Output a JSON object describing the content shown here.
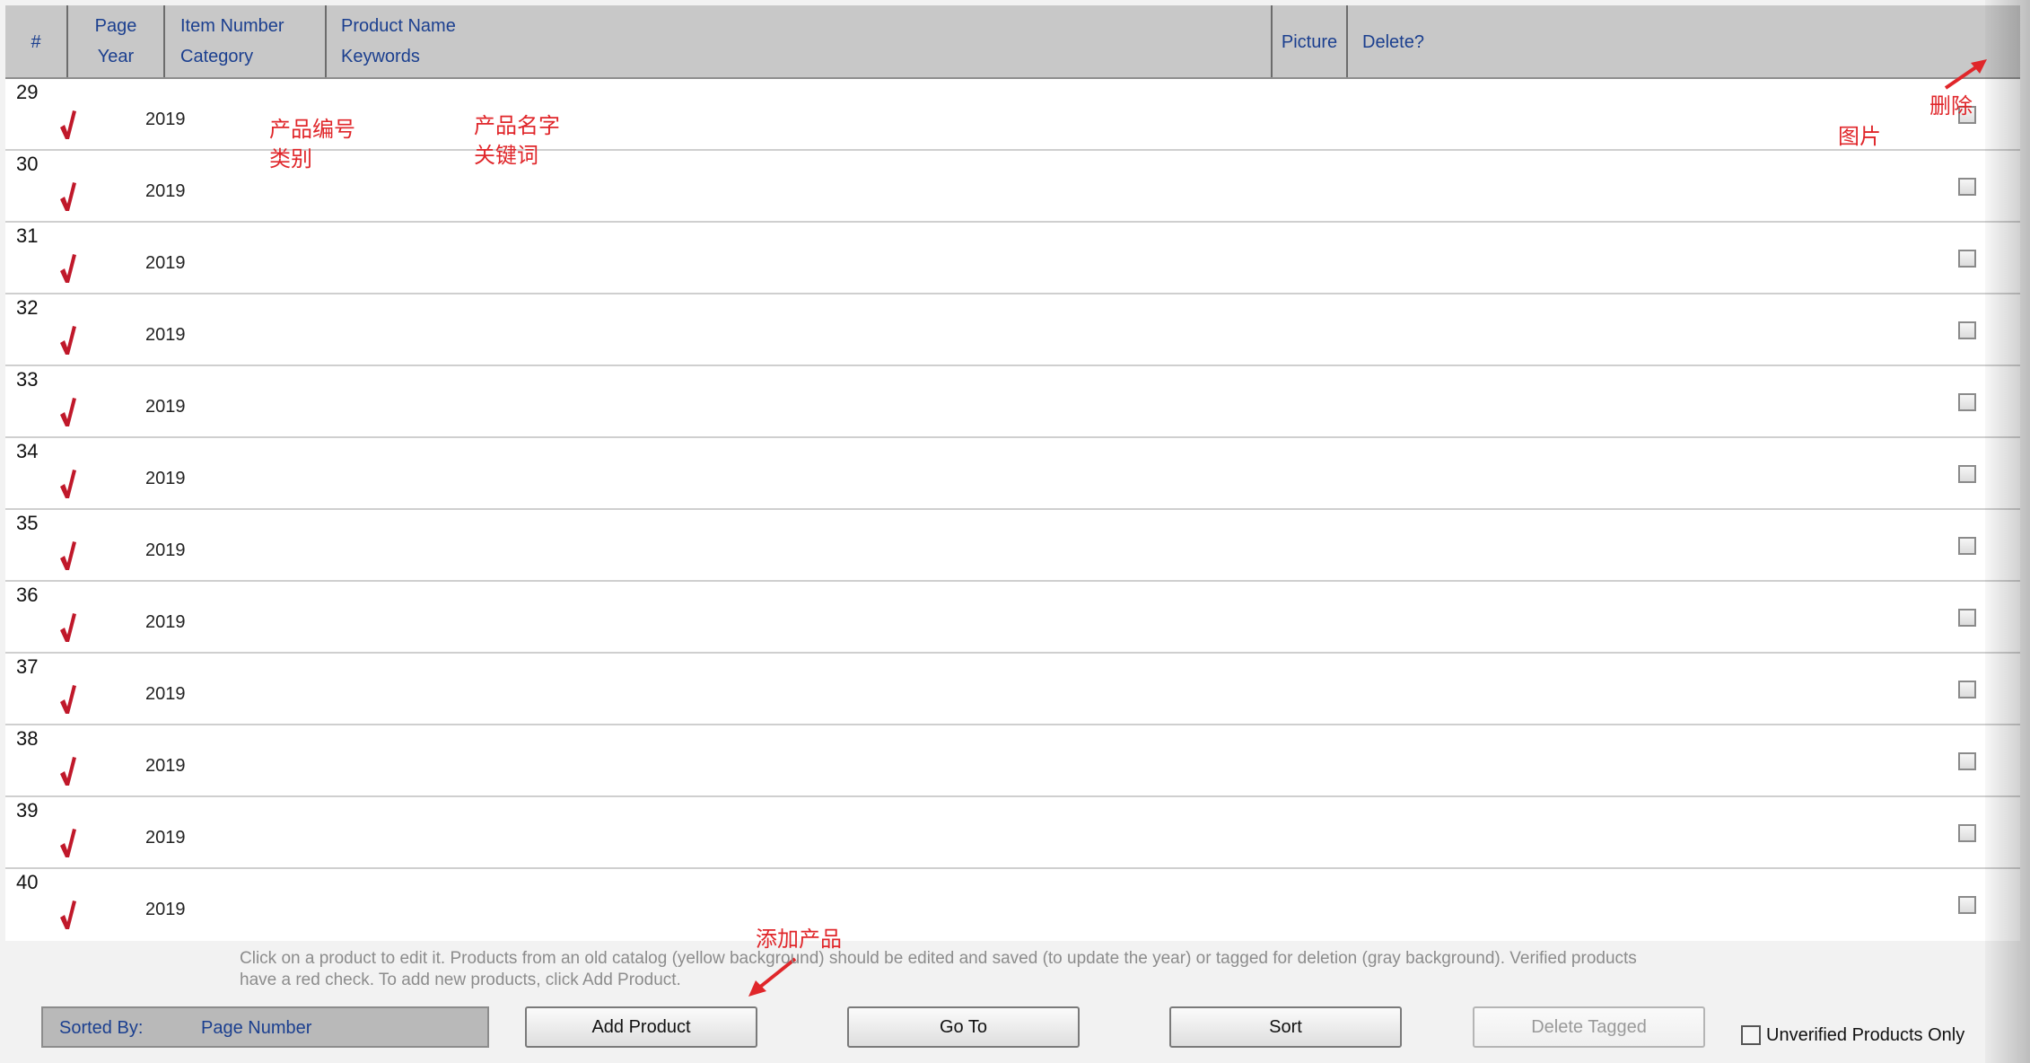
{
  "header": {
    "num": "#",
    "page": "Page",
    "year": "Year",
    "item_number": "Item Number",
    "category": "Category",
    "product_name": "Product Name",
    "keywords": "Keywords",
    "picture": "Picture",
    "delete": "Delete?"
  },
  "rows": [
    {
      "num": "29",
      "year": "2019"
    },
    {
      "num": "30",
      "year": "2019"
    },
    {
      "num": "31",
      "year": "2019"
    },
    {
      "num": "32",
      "year": "2019"
    },
    {
      "num": "33",
      "year": "2019"
    },
    {
      "num": "34",
      "year": "2019"
    },
    {
      "num": "35",
      "year": "2019"
    },
    {
      "num": "36",
      "year": "2019"
    },
    {
      "num": "37",
      "year": "2019"
    },
    {
      "num": "38",
      "year": "2019"
    },
    {
      "num": "39",
      "year": "2019"
    },
    {
      "num": "40",
      "year": "2019"
    }
  ],
  "annotations": {
    "item_category_l1": "产品编号",
    "item_category_l2": "类别",
    "name_keywords_l1": "产品名字",
    "name_keywords_l2": "关键词",
    "picture": "图片",
    "delete": "删除",
    "add_product": "添加产品"
  },
  "footer": {
    "help_line1": "Click on a product to edit it.  Products from an old catalog (yellow background) should be edited and saved (to update the year) or tagged for deletion (gray background).  Verified products",
    "help_line2": "have a red check.  To add new products, click Add Product.",
    "sorted_label": "Sorted By:",
    "sorted_value": "Page Number",
    "add_product": "Add Product",
    "go_to": "Go To",
    "sort": "Sort",
    "delete_tagged": "Delete Tagged",
    "unverified_only": "Unverified Products Only"
  },
  "colors": {
    "header_bg": "#c8c8c8",
    "header_text": "#1b3f8f",
    "check": "#c0182a",
    "annotation": "#e0262a"
  },
  "icons": {
    "verified": "red-check-icon",
    "delete_toggle": "checkbox"
  }
}
